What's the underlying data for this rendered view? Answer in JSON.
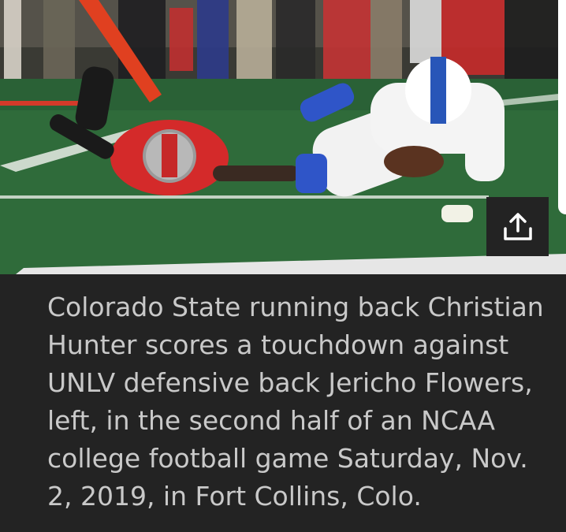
{
  "photo": {
    "alt_icon": "football-photo",
    "share_icon": "share-icon"
  },
  "caption": {
    "text": "Colorado State running back Christian Hunter scores a touchdown against UNLV defensive back Jericho Flowers, left, in the second half of an NCAA college football game Saturday, Nov. 2, 2019, in Fort Collins, Colo."
  },
  "colors": {
    "background": "#232323",
    "caption_text": "#c9c9c9",
    "field_green": "#2f6b3a",
    "unlv_red": "#d42a2a",
    "csu_white": "#f2f2f2"
  }
}
